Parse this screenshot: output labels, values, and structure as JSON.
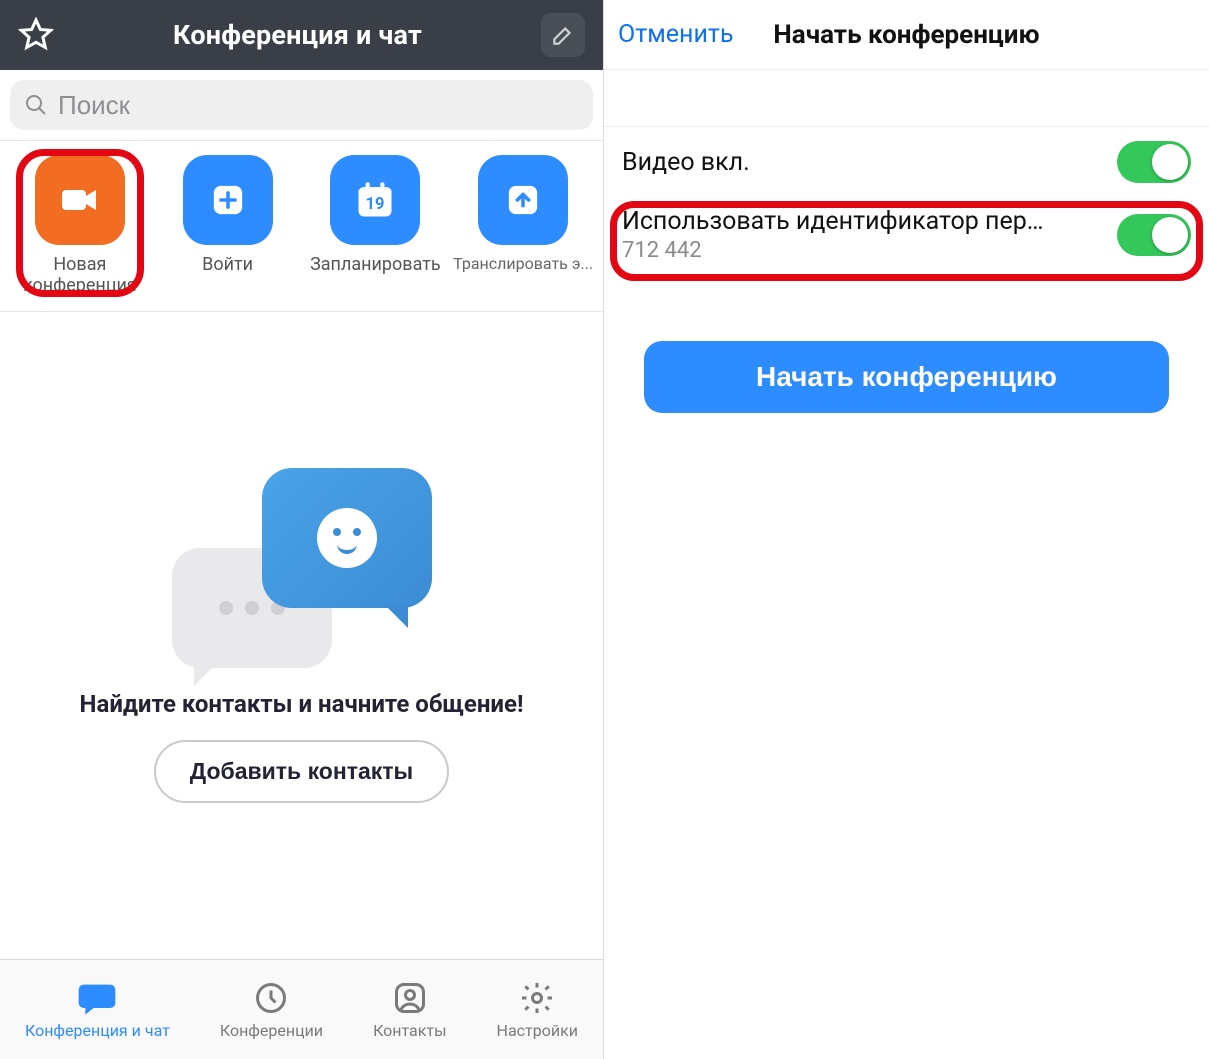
{
  "left": {
    "header_title": "Конференция и чат",
    "search_placeholder": "Поиск",
    "actions": {
      "new_meeting": "Новая\nконференция",
      "join": "Войти",
      "schedule": "Запланировать",
      "schedule_day": "19",
      "share": "Транслировать э..."
    },
    "empty": {
      "title": "Найдите контакты и начните общение!",
      "add_contacts": "Добавить контакты"
    },
    "tabs": {
      "chat": "Конференция и чат",
      "meetings": "Конференции",
      "contacts": "Контакты",
      "settings": "Настройки"
    }
  },
  "right": {
    "cancel": "Отменить",
    "title": "Начать конференцию",
    "video_on_label": "Видео вкл.",
    "pmi_label": "Использовать идентификатор перс...",
    "pmi_value": "712 442",
    "start_button": "Начать конференцию"
  },
  "colors": {
    "accent_blue": "#2d8cff",
    "accent_orange": "#f26d21",
    "highlight_red": "#e30613",
    "toggle_green": "#34c759"
  }
}
